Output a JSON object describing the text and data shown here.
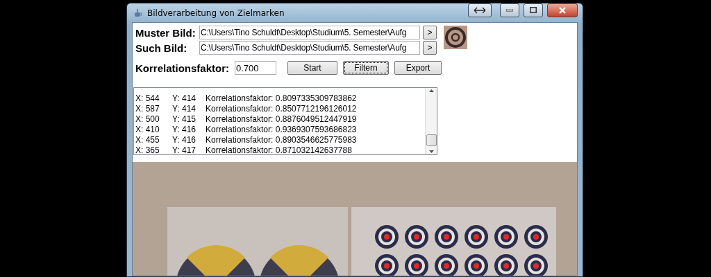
{
  "window": {
    "title": "Bildverarbeitung von Zielmarken"
  },
  "fields": [
    {
      "label": "Muster Bild:",
      "value": "C:\\Users\\Tino Schuldt\\Desktop\\Studium\\5. Semester\\Aufg",
      "button": ">"
    },
    {
      "label": "Such Bild:",
      "value": "C:\\Users\\Tino Schuldt\\Desktop\\Studium\\5. Semester\\Aufg",
      "button": ">"
    }
  ],
  "factor": {
    "label": "Korrelationsfaktor:",
    "value": "0.700"
  },
  "buttons": [
    {
      "label": "Start",
      "focused": false
    },
    {
      "label": "Filtern",
      "focused": true
    },
    {
      "label": "Export",
      "focused": false
    }
  ],
  "results": [
    {
      "x": "X: 544",
      "y": "Y: 414",
      "factor": "Korrelationsfaktor: 0.8097335309783862"
    },
    {
      "x": "X: 587",
      "y": "Y: 414",
      "factor": "Korrelationsfaktor: 0.8507712196126012"
    },
    {
      "x": "X: 500",
      "y": "Y: 415",
      "factor": "Korrelationsfaktor: 0.8876049512447919"
    },
    {
      "x": "X: 410",
      "y": "Y: 416",
      "factor": "Korrelationsfaktor: 0.9369307593686823"
    },
    {
      "x": "X: 455",
      "y": "Y: 416",
      "factor": "Korrelationsfaktor: 0.8903546625775983"
    },
    {
      "x": "X: 365",
      "y": "Y: 417",
      "factor": "Korrelationsfaktor: 0.871032142637788"
    }
  ]
}
